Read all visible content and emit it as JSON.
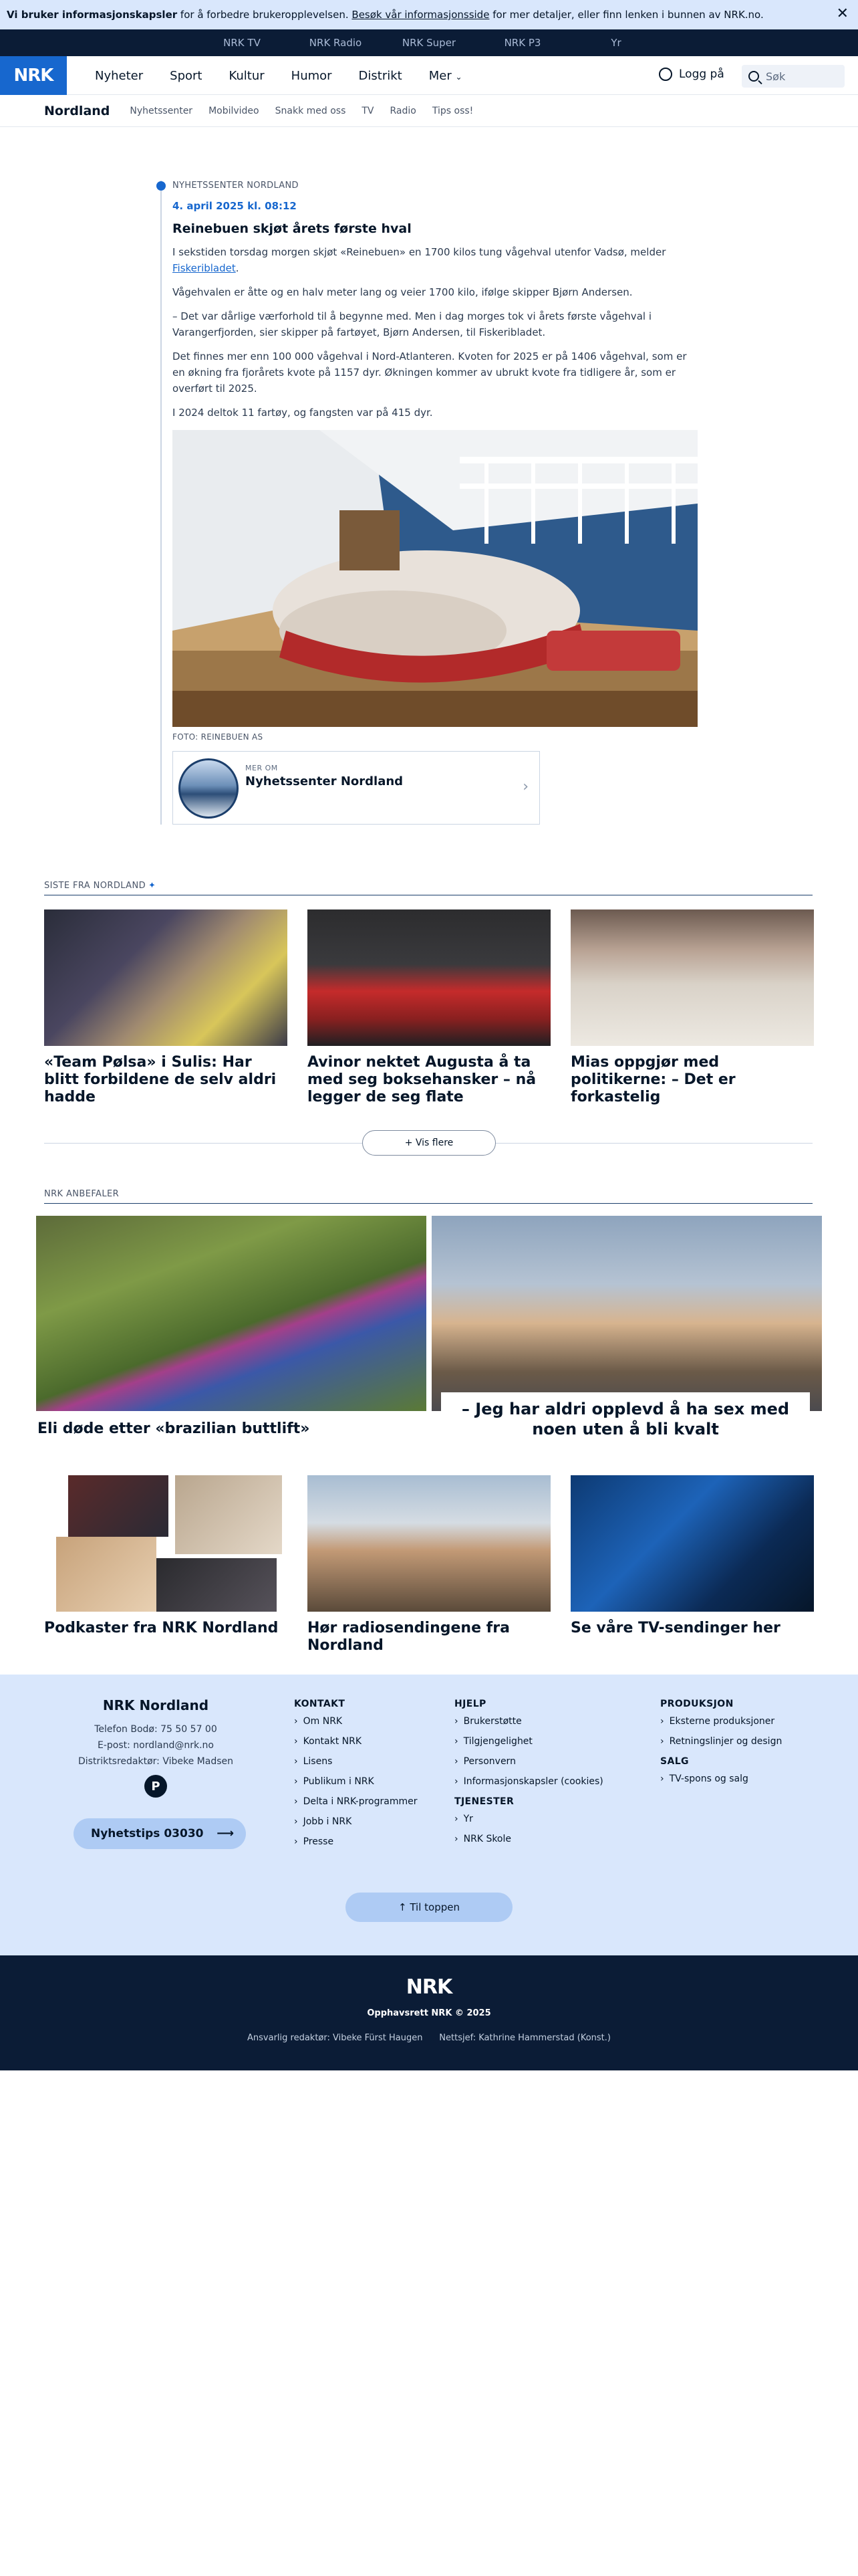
{
  "cookie": {
    "lead": "Vi bruker informasjonskapsler",
    "text1": " for å forbedre brukeropplevelsen. ",
    "link": "Besøk vår informasjonsside",
    "text2": " for mer detaljer, eller finn lenken i bunnen av NRK.no.",
    "close": "✕"
  },
  "services": [
    "NRK TV",
    "NRK Radio",
    "NRK Super",
    "NRK P3",
    "Yr"
  ],
  "header": {
    "logo": "NRK",
    "nav": [
      "Nyheter",
      "Sport",
      "Kultur",
      "Humor",
      "Distrikt",
      "Mer"
    ],
    "login": "Logg på",
    "search_placeholder": "Søk"
  },
  "subnav": {
    "district": "Nordland",
    "links": [
      "Nyhetssenter",
      "Mobilvideo",
      "Snakk med oss",
      "TV",
      "Radio",
      "Tips oss!"
    ]
  },
  "article": {
    "kicker": "NYHETSSENTER NORDLAND",
    "time": "4. april 2025 kl. 08:12",
    "headline": "Reinebuen skjøt årets første hval",
    "p1a": "I sekstiden torsdag morgen skjøt «Reinebuen» en 1700 kilos tung vågehval utenfor Vadsø, melder ",
    "p1link": "Fiskeribladet",
    "p1b": ".",
    "p2": "Vågehvalen er åtte og en halv meter lang og veier 1700 kilo, ifølge skipper Bjørn Andersen.",
    "p3": "– Det var dårlige værforhold til å begynne med. Men i dag morges tok vi årets første vågehval i Varangerfjorden, sier skipper på fartøyet, Bjørn Andersen, til Fiskeribladet.",
    "p4": "Det finnes mer enn 100 000 vågehval i Nord-Atlanteren. Kvoten for 2025 er på 1406 vågehval, som er en økning fra fjorårets kvote på 1157 dyr. Økningen kommer av ubrukt kvote fra tidligere år, som er overført til 2025.",
    "p5": "I 2024 deltok 11 fartøy, og fangsten var på 415 dyr.",
    "caption": "FOTO: REINEBUEN AS",
    "more_label": "MER OM",
    "more_name": "Nyhetssenter Nordland"
  },
  "latest": {
    "title": "SISTE FRA NORDLAND",
    "cards": [
      {
        "title": "«Team Pølsa» i Sulis: Har blitt forbildene de selv aldri hadde"
      },
      {
        "title": "Avinor nektet Augusta å ta med seg boksehansker – nå legger de seg flate"
      },
      {
        "title": "Mias oppgjør med politikerne: – Det er forkastelig"
      }
    ],
    "more_button": "+ Vis flere"
  },
  "recommended": {
    "title": "NRK ANBEFALER",
    "big": [
      {
        "title": "Eli døde etter «brazilian buttlift»"
      },
      {
        "title": "– Jeg har aldri opplevd å ha sex med noen uten å bli kvalt"
      }
    ],
    "cards": [
      {
        "title": "Podkaster fra NRK Nordland"
      },
      {
        "title": "Hør radiosendingene fra Nordland"
      },
      {
        "title": "Se våre TV-sendinger her"
      }
    ]
  },
  "footer": {
    "brand": "NRK Nordland",
    "phone": "Telefon Bodø:  75 50 57 00",
    "email": "E-post:  nordland@nrk.no",
    "editor": "Distriktsredaktør:  Vibeke Madsen",
    "picon": "P",
    "tips": "Nyhetstips 03030",
    "tips_arrow": "⟶",
    "kontakt_h": "KONTAKT",
    "kontakt": [
      "Om NRK",
      "Kontakt NRK",
      "Lisens",
      "Publikum i NRK",
      "Delta i NRK-programmer",
      "Jobb i NRK",
      "Presse"
    ],
    "hjelp_h": "HJELP",
    "hjelp": [
      "Brukerstøtte",
      "Tilgjengelighet",
      "Personvern",
      "Informasjonskapsler (cookies)"
    ],
    "tjenester_h": "TJENESTER",
    "tjenester": [
      "Yr",
      "NRK Skole"
    ],
    "produksjon_h": "PRODUKSJON",
    "produksjon": [
      "Eksterne produksjoner",
      "Retningslinjer og design"
    ],
    "salg_h": "SALG",
    "salg": [
      "TV-spons og salg"
    ],
    "totop": "↑  Til toppen"
  },
  "bottom": {
    "logo": "NRK",
    "copyright": "Opphavsrett NRK © 2025",
    "editors": "Ansvarlig redaktør: Vibeke Fürst Haugen      Nettsjef: Kathrine Hammerstad (Konst.)"
  }
}
